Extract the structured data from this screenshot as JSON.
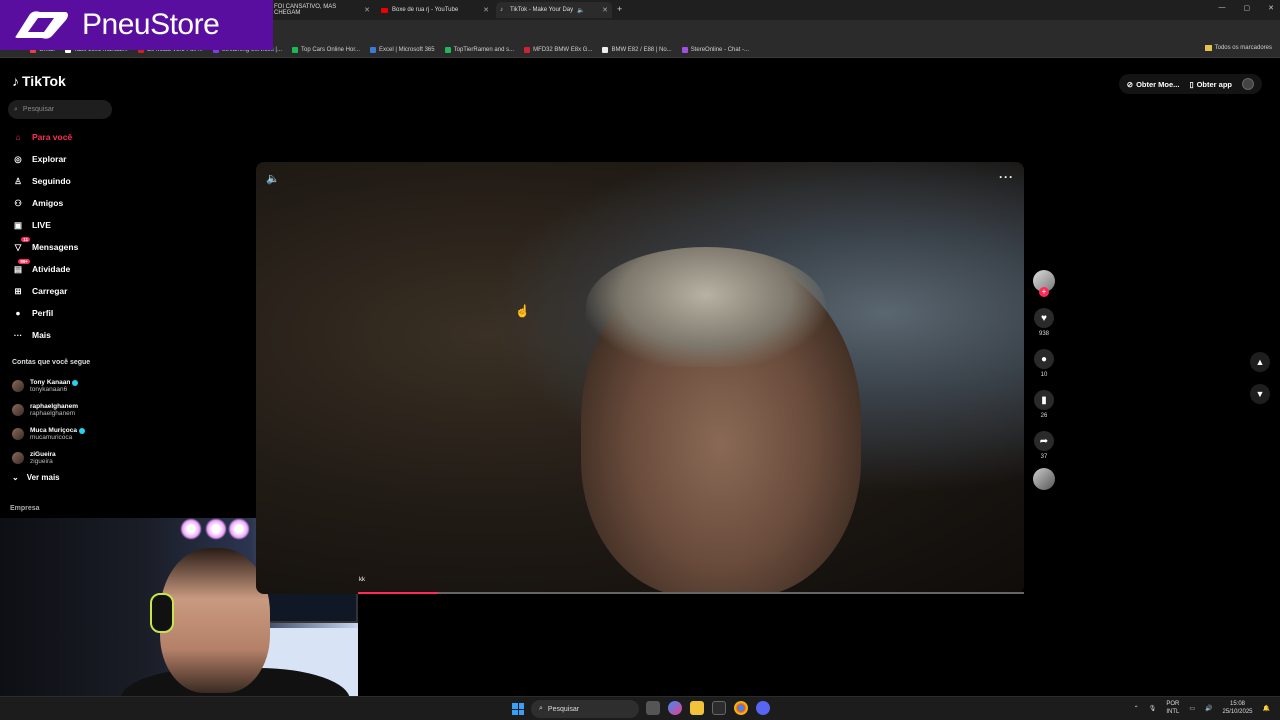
{
  "brand": {
    "name": "PneuStore"
  },
  "browser": {
    "tabs": [
      {
        "title": "FOI CANSATIVO, MAS CHEGAM",
        "active": false
      },
      {
        "title": "Boxe de rua rj - YouTube",
        "active": false
      },
      {
        "title": "TikTok - Make Your Day",
        "active": true
      }
    ],
    "bookmarks": [
      "Gmail",
      "Tabs-zo05 Manual...",
      "Li",
      "Ce Miata V2.5 Full ...",
      "Streaming Services |...",
      "Top Cars Online Hor...",
      "Excel | Microsoft 365",
      "TopTierRamen and s...",
      "MFD32 BMW E8x G...",
      "BMW E82 / E88 | No...",
      "StereOnline - Chat -..."
    ],
    "bookmarks_right": "Todos os marcadores"
  },
  "tiktok": {
    "logo": "TikTok",
    "search_placeholder": "Pesquisar",
    "nav": [
      {
        "label": "Para você",
        "icon": "home-icon",
        "active": true
      },
      {
        "label": "Explorar",
        "icon": "compass-icon"
      },
      {
        "label": "Seguindo",
        "icon": "following-icon"
      },
      {
        "label": "Amigos",
        "icon": "friends-icon"
      },
      {
        "label": "LIVE",
        "icon": "live-icon"
      },
      {
        "label": "Mensagens",
        "icon": "messages-icon",
        "badge": "11"
      },
      {
        "label": "Atividade",
        "icon": "activity-icon",
        "badge": "99+"
      },
      {
        "label": "Carregar",
        "icon": "upload-icon"
      },
      {
        "label": "Perfil",
        "icon": "profile-icon"
      },
      {
        "label": "Mais",
        "icon": "more-icon"
      }
    ],
    "following_title": "Contas que você segue",
    "following": [
      {
        "name": "Tony Kanaan",
        "handle": "tonykanaan6",
        "verified": true
      },
      {
        "name": "raphaelghanem",
        "handle": "raphaelghanem",
        "verified": false
      },
      {
        "name": "Muca Muriçoca",
        "handle": "mucamuricoca",
        "verified": true
      },
      {
        "name": "ziGueira",
        "handle": "zigueira",
        "verified": false
      }
    ],
    "see_more": "Ver mais",
    "company": "Empresa",
    "top_actions": {
      "coins": "Obter Moe...",
      "app": "Obter app"
    },
    "video": {
      "progress_label": "kk",
      "progress": 0.12
    },
    "actions": {
      "likes": "938",
      "comments": "10",
      "saves": "26",
      "shares": "37"
    }
  },
  "taskbar": {
    "search_placeholder": "Pesquisar",
    "lang_1": "POR",
    "lang_2": "INTL",
    "time": "15:08",
    "date": "25/10/2025"
  },
  "colors": {
    "accent": "#fe2c55",
    "brand": "#5a0ea0"
  }
}
